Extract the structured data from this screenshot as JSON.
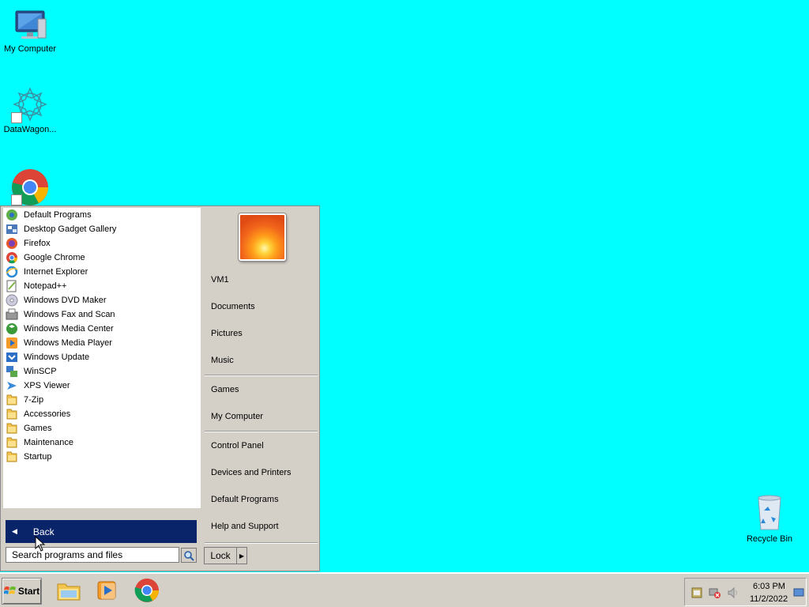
{
  "desktop": {
    "icons": [
      {
        "label": "My Computer",
        "icon": "computer-icon"
      },
      {
        "label": "DataWagon...",
        "icon": "datawagon-icon"
      },
      {
        "label": "",
        "icon": "chrome-icon"
      },
      {
        "label": "Recycle Bin",
        "icon": "recycle-bin-icon"
      }
    ],
    "background_color": "#00ffff"
  },
  "start_menu": {
    "programs": [
      {
        "label": "Default Programs",
        "icon": "default-programs-icon"
      },
      {
        "label": "Desktop Gadget Gallery",
        "icon": "gadget-icon"
      },
      {
        "label": "Firefox",
        "icon": "firefox-icon"
      },
      {
        "label": "Google Chrome",
        "icon": "chrome-icon"
      },
      {
        "label": "Internet Explorer",
        "icon": "ie-icon"
      },
      {
        "label": "Notepad++",
        "icon": "notepad-plus-icon"
      },
      {
        "label": "Windows DVD Maker",
        "icon": "dvd-icon"
      },
      {
        "label": "Windows Fax and Scan",
        "icon": "fax-icon"
      },
      {
        "label": "Windows Media Center",
        "icon": "media-center-icon"
      },
      {
        "label": "Windows Media Player",
        "icon": "media-player-icon"
      },
      {
        "label": "Windows Update",
        "icon": "update-icon"
      },
      {
        "label": "WinSCP",
        "icon": "winscp-icon"
      },
      {
        "label": "XPS Viewer",
        "icon": "xps-icon"
      },
      {
        "label": "7-Zip",
        "icon": "folder-icon"
      },
      {
        "label": "Accessories",
        "icon": "folder-icon"
      },
      {
        "label": "Games",
        "icon": "folder-icon"
      },
      {
        "label": "Maintenance",
        "icon": "folder-icon"
      },
      {
        "label": "Startup",
        "icon": "folder-icon"
      }
    ],
    "back_label": "Back",
    "search_placeholder": "Search programs and files",
    "right_items": {
      "user": "VM1",
      "documents": "Documents",
      "pictures": "Pictures",
      "music": "Music",
      "games": "Games",
      "my_computer": "My Computer",
      "control_panel": "Control Panel",
      "devices_printers": "Devices and Printers",
      "default_programs": "Default Programs",
      "help_support": "Help and Support"
    },
    "lock_label": "Lock"
  },
  "taskbar": {
    "start_label": "Start",
    "apps": [
      {
        "icon": "explorer-folder-icon"
      },
      {
        "icon": "media-player-icon"
      },
      {
        "icon": "chrome-icon"
      }
    ],
    "clock": {
      "time": "6:03 PM",
      "date": "11/2/2022"
    }
  }
}
